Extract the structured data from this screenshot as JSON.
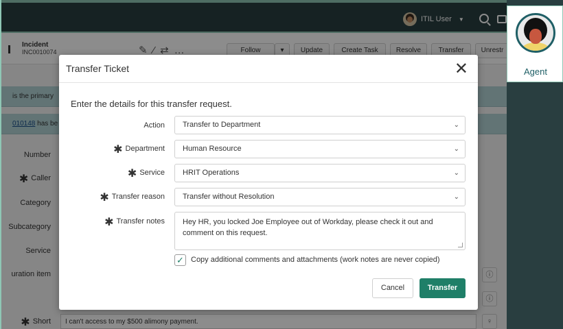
{
  "topbar": {
    "user_name": "ITIL User"
  },
  "record": {
    "title": "Incident",
    "number": "INC0010074",
    "buttons": [
      "Follow",
      "▾",
      "Update",
      "Create Task",
      "Resolve",
      "Transfer",
      "Unrestr"
    ]
  },
  "info_bars": {
    "primary_text": "is the primary",
    "link_text": "010148",
    "link_suffix": " has be"
  },
  "form_labels": {
    "number": "Number",
    "caller": "Caller",
    "category": "Category",
    "subcategory": "Subcategory",
    "service": "Service",
    "config_item": "uration item",
    "short": "Short"
  },
  "short_description": "I can't access to my $500 alimony payment.",
  "dialog": {
    "title": "Transfer Ticket",
    "intro": "Enter the details for this transfer request.",
    "fields": {
      "action": {
        "label": "Action",
        "value": "Transfer to Department"
      },
      "department": {
        "label": "Department",
        "value": "Human Resource"
      },
      "service": {
        "label": "Service",
        "value": "HRIT Operations"
      },
      "reason": {
        "label": "Transfer reason",
        "value": "Transfer without Resolution"
      },
      "notes": {
        "label": "Transfer notes",
        "value": "Hey HR, you locked Joe Employee out of Workday, please check it out and comment on this request."
      }
    },
    "copy_checkbox": {
      "label": "Copy additional comments and attachments (work notes are never copied)",
      "checked": true
    },
    "cancel_label": "Cancel",
    "transfer_label": "Transfer"
  },
  "agent_panel": {
    "label": "Agent"
  },
  "colors": {
    "accent": "#1f7f68",
    "topbar": "#293e40",
    "info_bar": "#b3d3d6"
  }
}
